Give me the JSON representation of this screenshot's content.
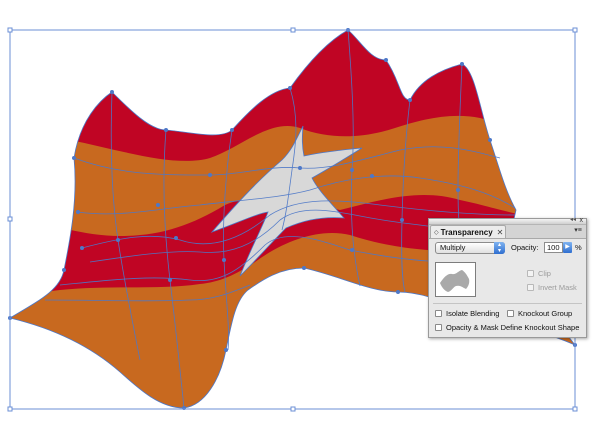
{
  "canvas": {
    "colors": {
      "red": "#c00524",
      "orange": "#c8691f",
      "star_gray": "#d8d8d8",
      "mesh_blue": "#4d78c8",
      "selection": "#6b8fd6"
    }
  },
  "panel": {
    "tab_label": "Transparency",
    "tab_arrows": "◇",
    "tab_close": "✕",
    "close_x": "x",
    "collapse_icon": "◂◂",
    "menu_icon": "▾≡",
    "blend_mode": "Multiply",
    "opacity_label": "Opacity:",
    "opacity_value": "100",
    "opacity_unit": "%",
    "clip_label": "Clip",
    "invert_mask_label": "Invert Mask",
    "isolate_blending_label": "Isolate Blending",
    "knockout_group_label": "Knockout Group",
    "opacity_mask_label": "Opacity & Mask Define Knockout Shape"
  }
}
